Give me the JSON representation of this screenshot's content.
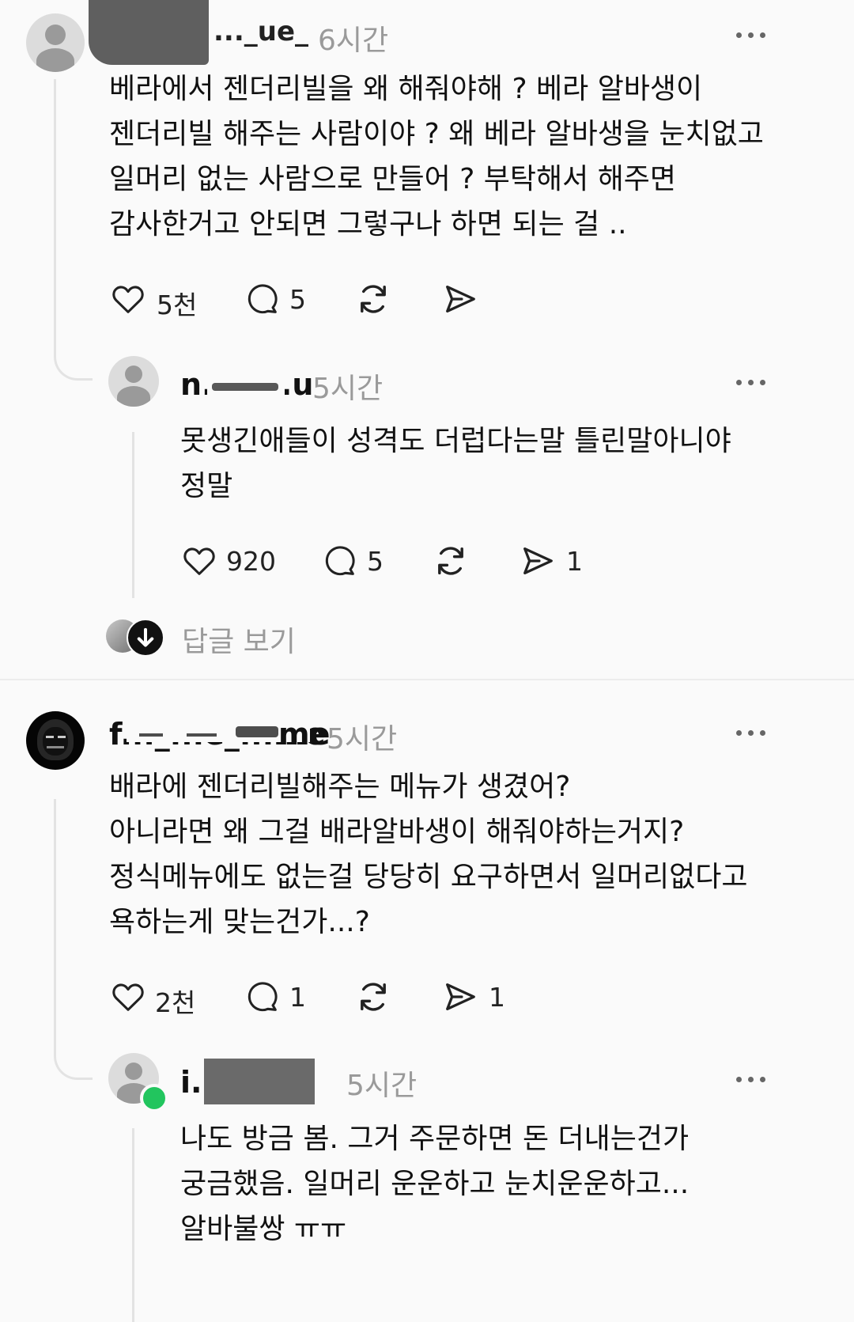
{
  "comments": [
    {
      "username": "..._ue_",
      "time": "6시간",
      "lines": [
        "베라에서 젠더리빌을 왜 해줘야해 ? 베라 알바생이",
        "젠더리빌 해주는 사람이야 ? 왜 베라 알바생을 눈치없고",
        "일머리 없는 사람으로 만들어 ? 부탁해서 해주면",
        "감사한거고 안되면 그렇구나 하면 되는 걸 .."
      ],
      "likes": "5천",
      "replies": "5",
      "shares": ""
    },
    {
      "username": "n.... ...u",
      "time": "5시간",
      "lines": [
        "못생긴애들이 성격도 더럽다는말 틀린말아니야",
        "정말"
      ],
      "likes": "920",
      "replies": "5",
      "shares": "1"
    },
    {
      "username": "f..._...e_...me",
      "time": "5시간",
      "lines": [
        "배라에 젠더리빌해주는 메뉴가 생겼어?",
        "아니라면 왜 그걸 배라알바생이 해줘야하는거지?",
        "정식메뉴에도 없는걸 당당히 요구하면서 일머리없다고",
        "욕하는게 맞는건가...?"
      ],
      "likes": "2천",
      "replies": "1",
      "shares": "1"
    },
    {
      "username": "i..._ _",
      "time": "5시간",
      "lines": [
        "나도 방금 봄. 그거 주문하면 돈 더내는건가",
        "궁금했음. 일머리 운운하고 눈치운운하고...",
        "알바불쌍 ㅠㅠ"
      ]
    }
  ],
  "view_replies_label": "답글 보기",
  "colors": {
    "text": "#111111",
    "muted": "#9a9a9a",
    "online": "#22c55e",
    "background": "#fafafa"
  }
}
